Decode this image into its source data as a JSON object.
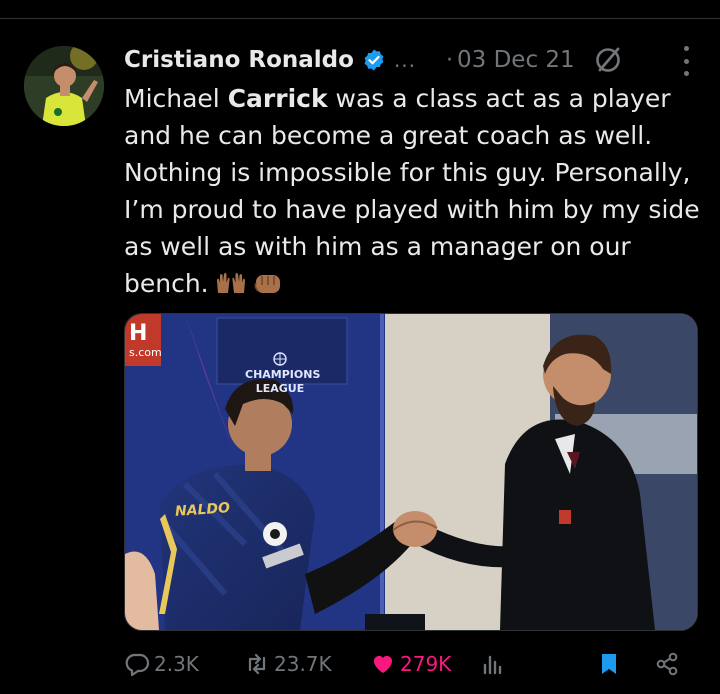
{
  "tweet": {
    "author_name": "Cristiano Ronaldo",
    "handle_truncated": "...",
    "separator": "·",
    "date": "03 Dec 21",
    "text_before": "Michael ",
    "text_bold": "Carrick",
    "text_after": " was a class act as a player\nand he can become a great coach as well.\nNothing is impossible for this guy. Personally,\nI’m proud to have played with him by my side\nas well as with him as a manager on our\nbench.",
    "emoji": [
      "raising-hands-emoji",
      "fist-emoji"
    ]
  },
  "media": {
    "banner_text": "CHAMPIONS\nLEAGUE",
    "jersey_text": "NALDO",
    "corner_text": "s.com"
  },
  "actions": {
    "reply_count": "2.3K",
    "retweet_count": "23.7K",
    "like_count": "279K",
    "views_label": ""
  },
  "colors": {
    "background": "#000000",
    "text": "#e7e9ea",
    "muted": "#71767b",
    "verified": "#1d9bf0",
    "like": "#f91880",
    "bookmark": "#1d9bf0"
  },
  "icons": [
    "verified-badge-icon",
    "grok-icon",
    "more-icon",
    "reply-icon",
    "retweet-icon",
    "like-icon",
    "views-icon",
    "bookmark-icon",
    "share-icon"
  ]
}
